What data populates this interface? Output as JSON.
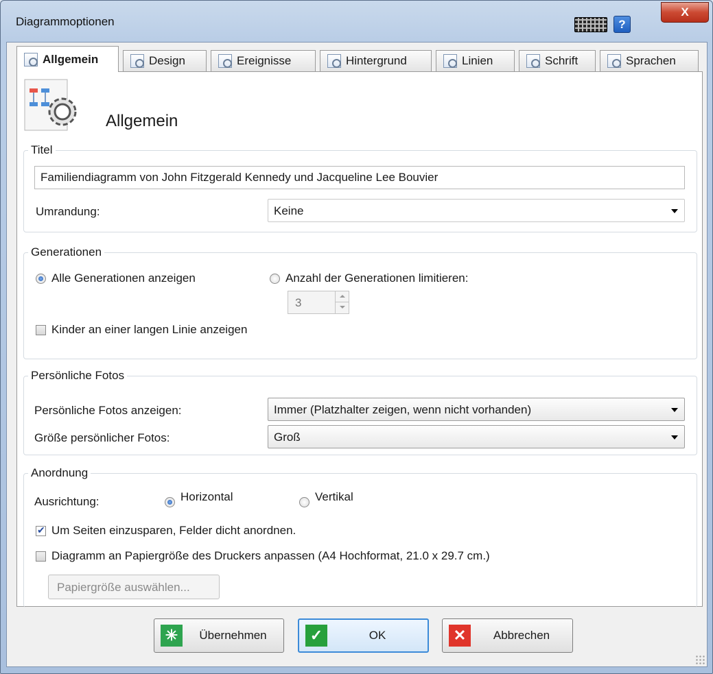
{
  "window": {
    "title": "Diagrammoptionen",
    "help_label": "?",
    "close_label": "X"
  },
  "tabs": [
    {
      "label": "Allgemein",
      "icon": "general-settings-icon"
    },
    {
      "label": "Design",
      "icon": "design-icon"
    },
    {
      "label": "Ereignisse",
      "icon": "events-icon"
    },
    {
      "label": "Hintergrund",
      "icon": "background-icon"
    },
    {
      "label": "Linien",
      "icon": "lines-icon"
    },
    {
      "label": "Schrift",
      "icon": "font-icon"
    },
    {
      "label": "Sprachen",
      "icon": "languages-icon"
    }
  ],
  "header": {
    "title": "Allgemein"
  },
  "titel_group": {
    "legend": "Titel",
    "title_value": "Familiendiagramm von John Fitzgerald Kennedy und Jacqueline Lee Bouvier",
    "border_label": "Umrandung:",
    "border_value": "Keine"
  },
  "generations": {
    "legend": "Generationen",
    "show_all_label": "Alle Generationen anzeigen",
    "show_all_selected": true,
    "limit_label": "Anzahl der Generationen limitieren:",
    "limit_selected": false,
    "limit_value": "3",
    "children_line_label": "Kinder an einer langen Linie anzeigen",
    "children_line_checked": false
  },
  "photos": {
    "legend": "Persönliche Fotos",
    "show_label": "Persönliche Fotos anzeigen:",
    "show_value": "Immer (Platzhalter zeigen, wenn nicht vorhanden)",
    "size_label": "Größe persönlicher Fotos:",
    "size_value": "Groß"
  },
  "arrangement": {
    "legend": "Anordnung",
    "orientation_label": "Ausrichtung:",
    "horizontal_label": "Horizontal",
    "horizontal_selected": true,
    "vertical_label": "Vertikal",
    "vertical_selected": false,
    "compact_label": "Um Seiten einzusparen, Felder dicht anordnen.",
    "compact_checked": true,
    "fit_paper_label": "Diagramm an Papiergröße des Druckers anpassen (A4 Hochformat, 21.0 x 29.7 cm.)",
    "fit_paper_checked": false,
    "paper_size_button": "Papiergröße auswählen..."
  },
  "footer": {
    "apply_label": "Übernehmen",
    "ok_label": "OK",
    "cancel_label": "Abbrechen"
  },
  "colors": {
    "apply_icon": "#2ea44f",
    "ok_icon": "#27a03c",
    "cancel_icon": "#e0352b"
  }
}
